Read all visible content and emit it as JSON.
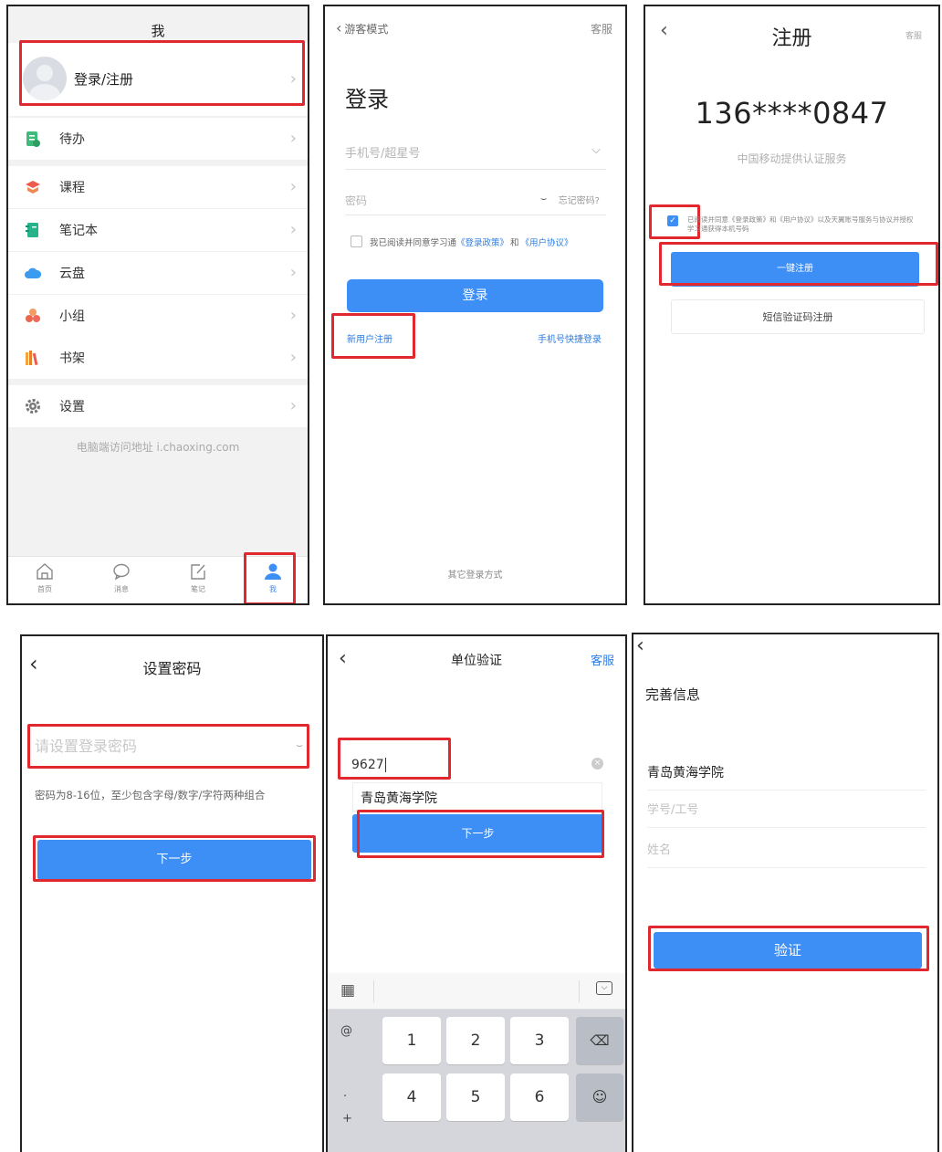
{
  "panel1": {
    "title": "我",
    "login_label": "登录/注册",
    "menu": [
      {
        "label": "待办",
        "icon": "todo-icon"
      },
      {
        "label": "课程",
        "icon": "course-icon"
      },
      {
        "label": "笔记本",
        "icon": "notebook-icon"
      },
      {
        "label": "云盘",
        "icon": "cloud-icon"
      },
      {
        "label": "小组",
        "icon": "group-icon"
      },
      {
        "label": "书架",
        "icon": "bookshelf-icon"
      }
    ],
    "settings_label": "设置",
    "footer_note": "电脑端访问地址 i.chaoxing.com",
    "tabs": [
      {
        "label": "首页",
        "icon": "home-icon"
      },
      {
        "label": "消息",
        "icon": "message-icon"
      },
      {
        "label": "笔记",
        "icon": "note-icon"
      },
      {
        "label": "我",
        "icon": "person-icon"
      }
    ]
  },
  "panel2": {
    "back_label": "游客模式",
    "service_label": "客服",
    "heading": "登录",
    "phone_placeholder": "手机号/超星号",
    "password_placeholder": "密码",
    "forgot_label": "忘记密码?",
    "agree_prefix": "我已阅读并同意学习通",
    "policy_link": "《登录政策》",
    "agree_and": "和",
    "agreement_link": "《用户协议》",
    "login_button": "登录",
    "register_link": "新用户注册",
    "quick_login_link": "手机号快捷登录",
    "other_methods": "其它登录方式"
  },
  "panel3": {
    "title": "注册",
    "service_label": "客服",
    "phone_number": "136****0847",
    "carrier_note": "中国移动提供认证服务",
    "agree_text": "已阅读并同意《登录政策》和《用户协议》以及天翼账号服务与协议并授权学习通获得本机号码",
    "one_click_button": "一键注册",
    "sms_button": "短信验证码注册"
  },
  "panel4": {
    "title": "设置密码",
    "password_placeholder": "请设置登录密码",
    "hint": "密码为8-16位，至少包含字母/数字/字符两种组合",
    "next_button": "下一步"
  },
  "panel5": {
    "title": "单位验证",
    "service_label": "客服",
    "input_value": "9627",
    "suggestion": "青岛黄海学院",
    "next_button": "下一步",
    "keyboard": {
      "side_keys": [
        "@",
        ".",
        "+"
      ],
      "digits": [
        "1",
        "2",
        "3",
        "4",
        "5",
        "6"
      ]
    }
  },
  "panel6": {
    "title": "完善信息",
    "school": "青岛黄海学院",
    "id_placeholder": "学号/工号",
    "name_placeholder": "姓名",
    "verify_button": "验证"
  },
  "colors": {
    "accent": "#3d8ef5",
    "highlight": "#e0282e",
    "link": "#2f7de1"
  }
}
